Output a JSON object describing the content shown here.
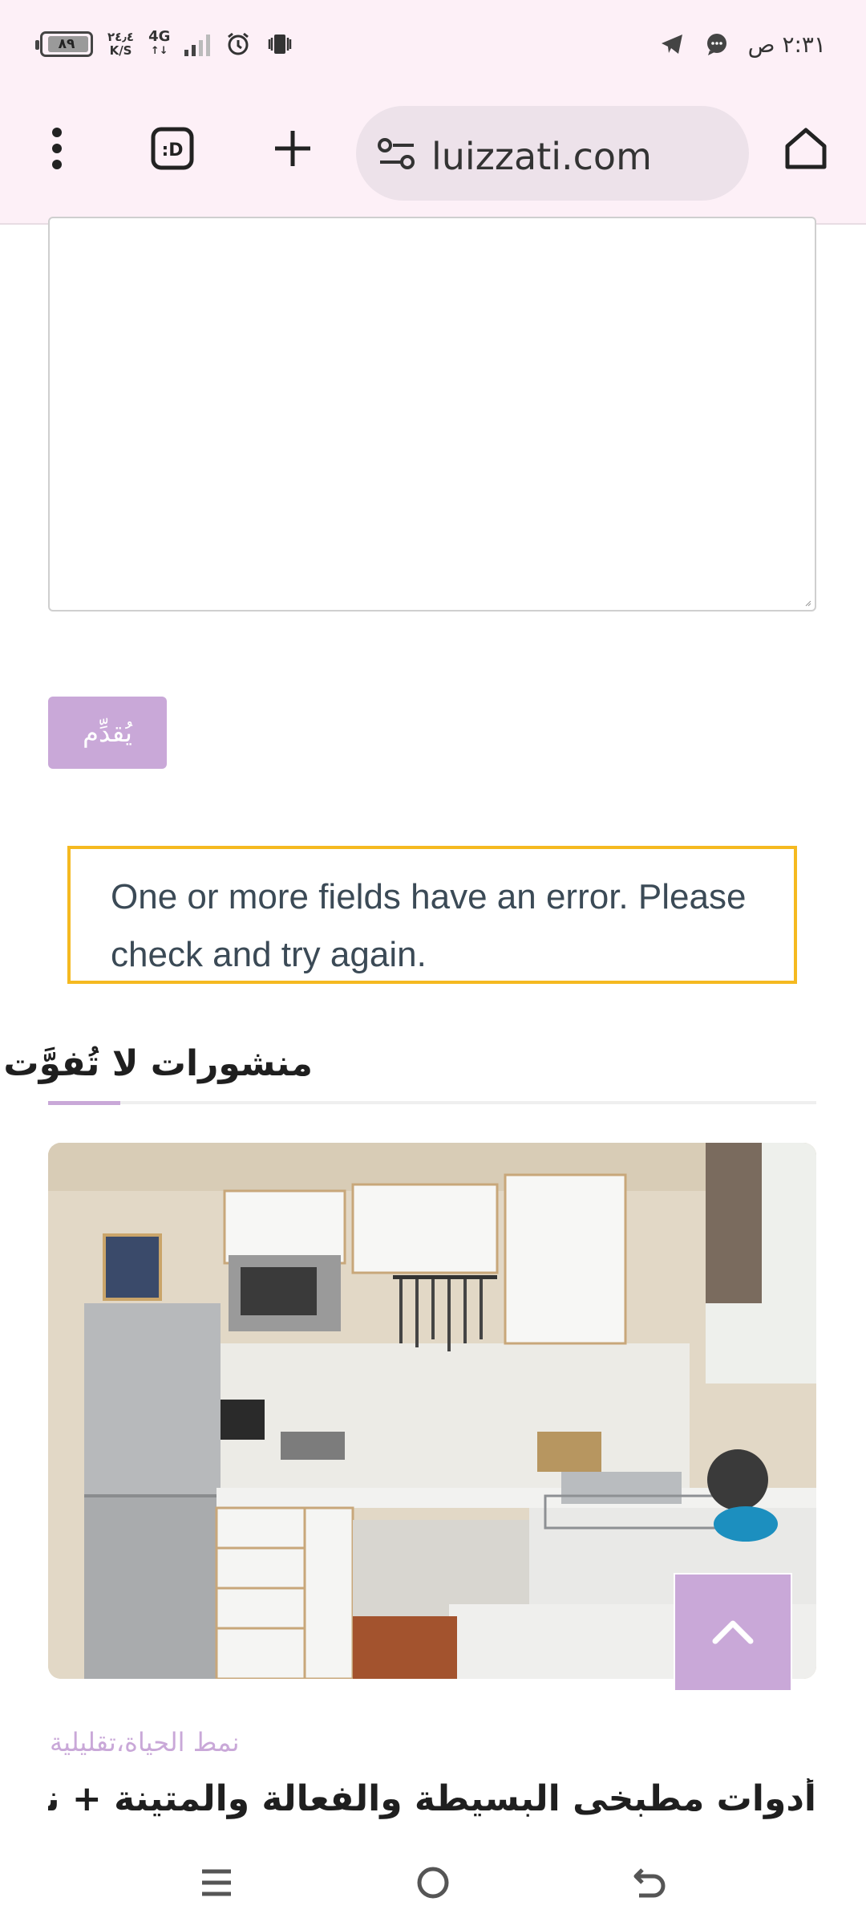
{
  "status_bar": {
    "battery_level": "٨٩",
    "net_speed_value": "٢٤٫٤",
    "net_speed_unit": "K/S",
    "network_type": "4G",
    "network_sub": "↑↓",
    "time": "٢:٣١ ص",
    "icons": [
      "alarm-icon",
      "vibrate-icon",
      "telegram-icon",
      "chat-bubble-icon"
    ]
  },
  "browser": {
    "url": "luizzati.com",
    "menu_icon": "more-vert-icon",
    "tabs_icon": "tab-switcher-icon",
    "new_tab_icon": "plus-icon",
    "site_settings_icon": "tune-icon",
    "home_icon": "home-icon"
  },
  "form": {
    "submit_label": "يُقدِّم",
    "error_message": "One or more fields have an error. Please check and try again."
  },
  "section": {
    "title": "منشورات لا تُفوَّت"
  },
  "post": {
    "categories": "نمط الحياة،تقليلية",
    "title": "أدوات مطبخى البسيطة والفعالة والمتينة + نصائح",
    "image_alt": "kitchen-photo"
  },
  "back_to_top_icon": "chevron-up-icon",
  "nav": {
    "icons": [
      "recents-icon",
      "home-circle-icon",
      "back-icon"
    ]
  },
  "colors": {
    "accent": "#c9a8d8",
    "error_border": "#f5b920",
    "bar_bg": "#fdf0f7"
  }
}
